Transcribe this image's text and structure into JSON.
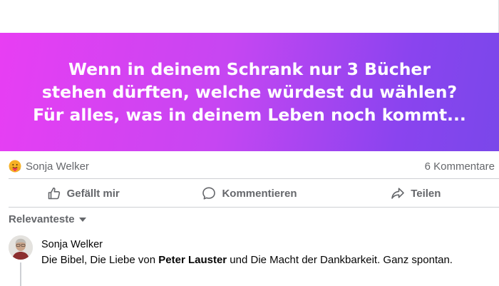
{
  "banner": {
    "lines": [
      "Wenn in deinem Schrank nur 3 Bücher",
      "stehen dürften, welche würdest du wählen?",
      "Für alles, was in deinem Leben noch kommt..."
    ],
    "gradient_start": "#e83ef3",
    "gradient_end": "#7a47ea"
  },
  "reactions": {
    "icon": "hug-emoji-icon",
    "name": "Sonja Welker",
    "comment_count": "6 Kommentare"
  },
  "actions": {
    "like": "Gefällt mir",
    "comment": "Kommentieren",
    "share": "Teilen"
  },
  "sort": {
    "label": "Relevanteste"
  },
  "comment": {
    "author": "Sonja Welker",
    "text_before": "Die Bibel, Die Liebe von ",
    "text_bold": "Peter Lauster",
    "text_after": " und Die Macht der Dankbarkeit. Ganz spontan."
  }
}
